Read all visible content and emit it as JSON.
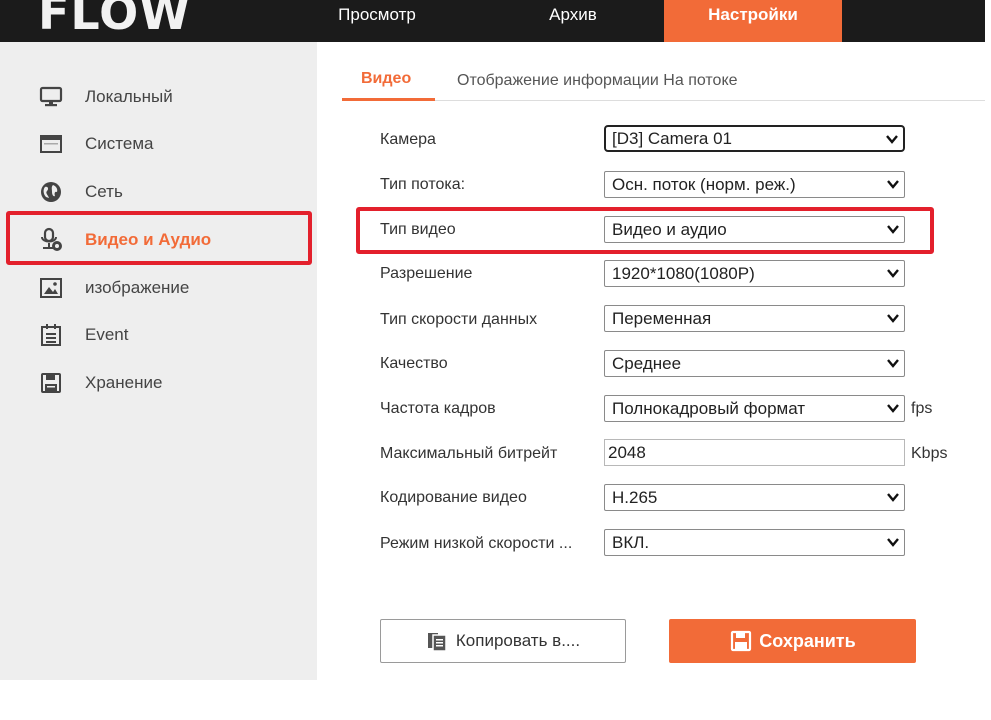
{
  "logo": "FLOW",
  "nav": [
    {
      "label": "Просмотр"
    },
    {
      "label": "Архив"
    },
    {
      "label": "Настройки"
    }
  ],
  "sidebar": {
    "items": [
      {
        "label": "Локальный",
        "icon": "monitor-icon"
      },
      {
        "label": "Система",
        "icon": "window-icon"
      },
      {
        "label": "Сеть",
        "icon": "globe-icon"
      },
      {
        "label": "Видео и Аудио",
        "icon": "microphone-icon"
      },
      {
        "label": "изображение",
        "icon": "image-icon"
      },
      {
        "label": "Event",
        "icon": "list-icon"
      },
      {
        "label": "Хранение",
        "icon": "floppy-icon"
      }
    ]
  },
  "tabs": [
    {
      "label": "Видео"
    },
    {
      "label": "Отображение информации На потоке"
    }
  ],
  "form": {
    "camera": {
      "label": "Камера",
      "value": "[D3] Camera 01"
    },
    "stream_type": {
      "label": "Тип потока:",
      "value": "Осн. поток (норм. реж.)"
    },
    "video_type": {
      "label": "Тип видео",
      "value": "Видео и аудио"
    },
    "resolution": {
      "label": "Разрешение",
      "value": "1920*1080(1080P)"
    },
    "bitrate_type": {
      "label": "Тип скорости данных",
      "value": "Переменная"
    },
    "quality": {
      "label": "Качество",
      "value": "Среднее"
    },
    "frame_rate": {
      "label": "Частота кадров",
      "value": "Полнокадровый формат",
      "unit": "fps"
    },
    "max_bitrate": {
      "label": "Максимальный битрейт",
      "value": "2048",
      "unit": "Kbps"
    },
    "encoding": {
      "label": "Кодирование видео",
      "value": "H.265"
    },
    "low_bitrate": {
      "label": "Режим низкой скорости ...",
      "value": "ВКЛ."
    }
  },
  "buttons": {
    "copy": "Копировать в....",
    "save": "Сохранить"
  },
  "colors": {
    "accent": "#f26b38",
    "highlight": "#e3202c",
    "topbar": "#1b1b1b"
  }
}
